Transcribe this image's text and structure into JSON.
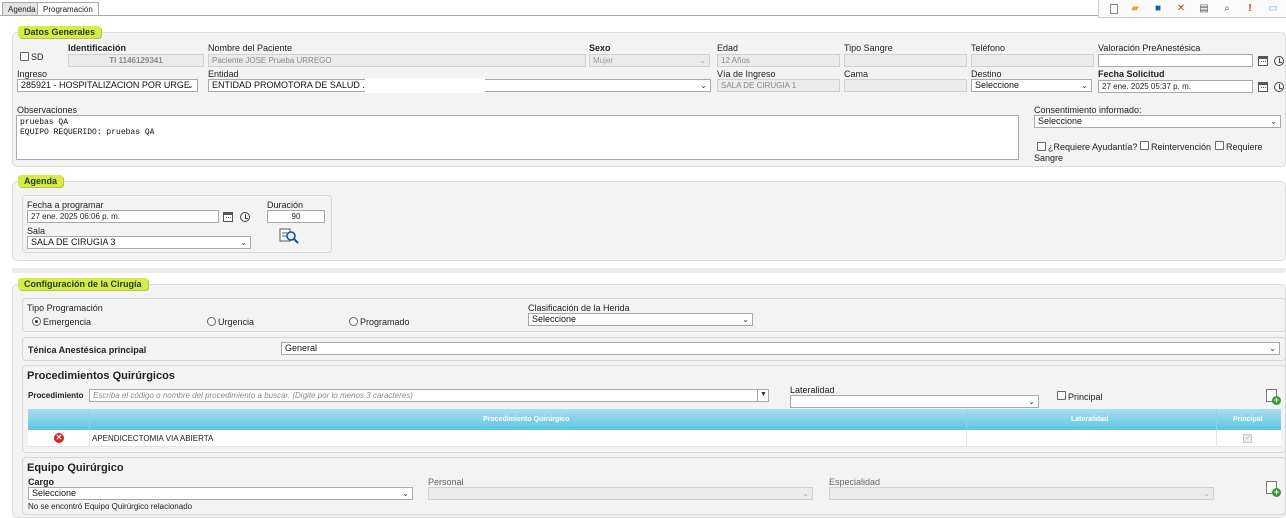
{
  "tabs": [
    {
      "label": "Agenda"
    },
    {
      "label": "Programación"
    }
  ],
  "toolbar": {
    "icons": [
      "new-document-icon",
      "folder-icon",
      "save-icon",
      "cancel-icon",
      "print-icon",
      "preview-icon",
      "alert-icon",
      "comment-icon"
    ]
  },
  "datos_generales": {
    "legend": "Datos Generales",
    "sd_label": "SD",
    "identificacion_label": "Identificación",
    "identificacion_value": "TI 1146129341",
    "nombre_label": "Nombre del Paciente",
    "nombre_value": "Paciente JOSE Prueba URREGO",
    "sexo_label": "Sexo",
    "sexo_value": "Mujer",
    "edad_label": "Edad",
    "edad_value": "12 Años",
    "tipo_sangre_label": "Tipo Sangre",
    "tipo_sangre_value": "",
    "telefono_label": "Teléfono",
    "telefono_value": "",
    "valoracion_label": "Valoración PreAnestésica",
    "valoracion_value": "",
    "ingreso_label": "Ingreso",
    "ingreso_value": "285921 - HOSPITALIZACION POR URGE",
    "entidad_label": "Entidad",
    "entidad_value": "ENTIDAD PROMOTORA DE SALUD ...",
    "via_ingreso_label": "Vía de Ingreso",
    "via_ingreso_value": "SALA DE CIRUGIA 1",
    "cama_label": "Cama",
    "cama_value": "",
    "destino_label": "Destino",
    "destino_value": "Seleccione",
    "fecha_solicitud_label": "Fecha Solicitud",
    "fecha_solicitud_value": "27 ene. 2025 05:37 p. m.",
    "observaciones_label": "Observaciones",
    "observaciones_value": "pruebas QA\nEQUIPO REQUERIDO: pruebas QA",
    "consentimiento_label": "Consentimiento informado:",
    "consentimiento_value": "Seleccione",
    "requiere_ayudantia_label": "¿Requiere Ayudantía?",
    "reintervencion_label": "Reintervención",
    "requiere_sangre_label_1": "Requiere",
    "requiere_sangre_label_2": "Sangre"
  },
  "agenda": {
    "legend": "Agenda",
    "fecha_label": "Fecha a programar",
    "fecha_value": "27 ene. 2025 06:06 p. m.",
    "duracion_label": "Duración",
    "duracion_value": "90",
    "sala_label": "Sala",
    "sala_value": "SALA DE CIRUGIA 3"
  },
  "configuracion": {
    "legend": "Configuración de la Cirugía",
    "tipo_programacion_label": "Tipo Programación",
    "radio_emergencia": "Emergencia",
    "radio_urgencia": "Urgencia",
    "radio_programado": "Programado",
    "selected_tipo": "Emergencia",
    "clasificacion_label": "Clasificación de la Herida",
    "clasificacion_value": "Seleccione",
    "tecnica_label": "Ténica Anestésica principal",
    "tecnica_value": "General"
  },
  "procedimientos": {
    "title": "Procedimientos Quirúrgicos",
    "procedimiento_label": "Procedimiento",
    "procedimiento_placeholder": "Escriba el código o nombre del procedimiento a buscar. (Digite por lo menos 3 caracteres)",
    "lateralidad_label": "Lateralidad",
    "lateralidad_value": "",
    "principal_label": "Principal",
    "columns": [
      "Procedimiento Quirúrgico",
      "Lateralidad",
      "Principal"
    ],
    "rows": [
      {
        "procedimiento": "APENDICECTOMIA VIA ABIERTA",
        "lateralidad": "",
        "principal": true
      }
    ]
  },
  "equipo": {
    "title": "Equipo Quirúrgico",
    "cargo_label": "Cargo",
    "cargo_value": "Seleccione",
    "personal_label": "Personal",
    "personal_value": "",
    "especialidad_label": "Especialidad",
    "especialidad_value": "",
    "empty_message": "No se encontró Equipo Quirúrgico relacionado"
  }
}
